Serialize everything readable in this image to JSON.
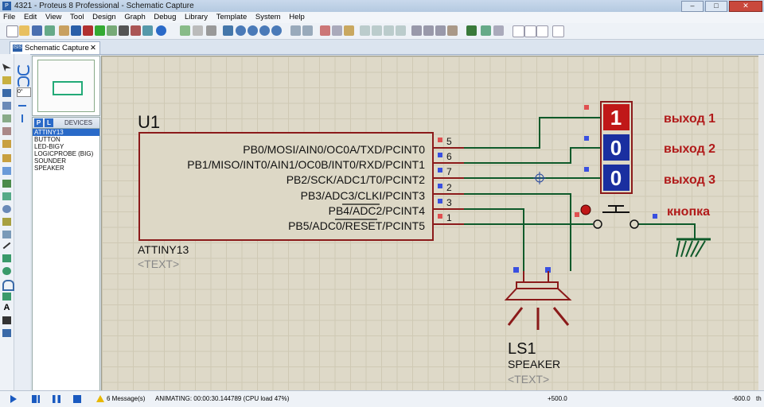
{
  "window": {
    "title": "4321 - Proteus 8 Professional - Schematic Capture",
    "minimize": "–",
    "maximize": "□",
    "close": "✕"
  },
  "menu": [
    "File",
    "Edit",
    "View",
    "Tool",
    "Design",
    "Graph",
    "Debug",
    "Library",
    "Template",
    "System",
    "Help"
  ],
  "tab": {
    "label": "Schematic Capture",
    "icon_text": "ISIS",
    "close": "✕"
  },
  "rotation": {
    "value": "0°"
  },
  "devices": {
    "p_label": "P",
    "l_label": "L",
    "header": "DEVICES",
    "items": [
      "ATTINY13",
      "BUTTON",
      "LED-BIGY",
      "LOGICPROBE (BIG)",
      "SOUNDER",
      "SPEAKER"
    ],
    "selected_index": 0
  },
  "schematic": {
    "mcu": {
      "ref": "U1",
      "part": "ATTINY13",
      "text_placeholder": "<TEXT>",
      "pins": [
        {
          "label": "PB0/MOSI/AIN0/OC0A/TXD/PCINT0",
          "num": "5"
        },
        {
          "label": "PB1/MISO/INT0/AIN1/OC0B/INT0/RXD/PCINT1",
          "num": "6"
        },
        {
          "label": "PB2/SCK/ADC1/T0/PCINT2",
          "num": "7"
        },
        {
          "label": "PB3/ADC3/CLKI/PCINT3",
          "num": "2"
        },
        {
          "label": "PB4/ADC2/PCINT4",
          "num": "3"
        },
        {
          "label": "PB5/ADC0/RESET/PCINT5",
          "num": "1"
        }
      ]
    },
    "probes": [
      {
        "value": "1",
        "label": "выход 1",
        "color": "#c01818"
      },
      {
        "value": "0",
        "label": "выход 2",
        "color": "#1a2fa0"
      },
      {
        "value": "0",
        "label": "выход 3",
        "color": "#1a2fa0"
      }
    ],
    "button_label": "кнопка",
    "speaker": {
      "ref": "LS1",
      "part": "SPEAKER",
      "text_placeholder": "<TEXT>"
    },
    "colors": {
      "wire": "#0e5a2a",
      "body": "#8b1a1a",
      "fill": "#ddd8c6",
      "label_red": "#b11a1a"
    }
  },
  "status": {
    "messages": "6 Message(s)",
    "animating": "ANIMATING: 00:00:30.144789 (CPU load 47%)",
    "coord_x": "+500.0",
    "coord_y": "-600.0",
    "units": "th"
  }
}
